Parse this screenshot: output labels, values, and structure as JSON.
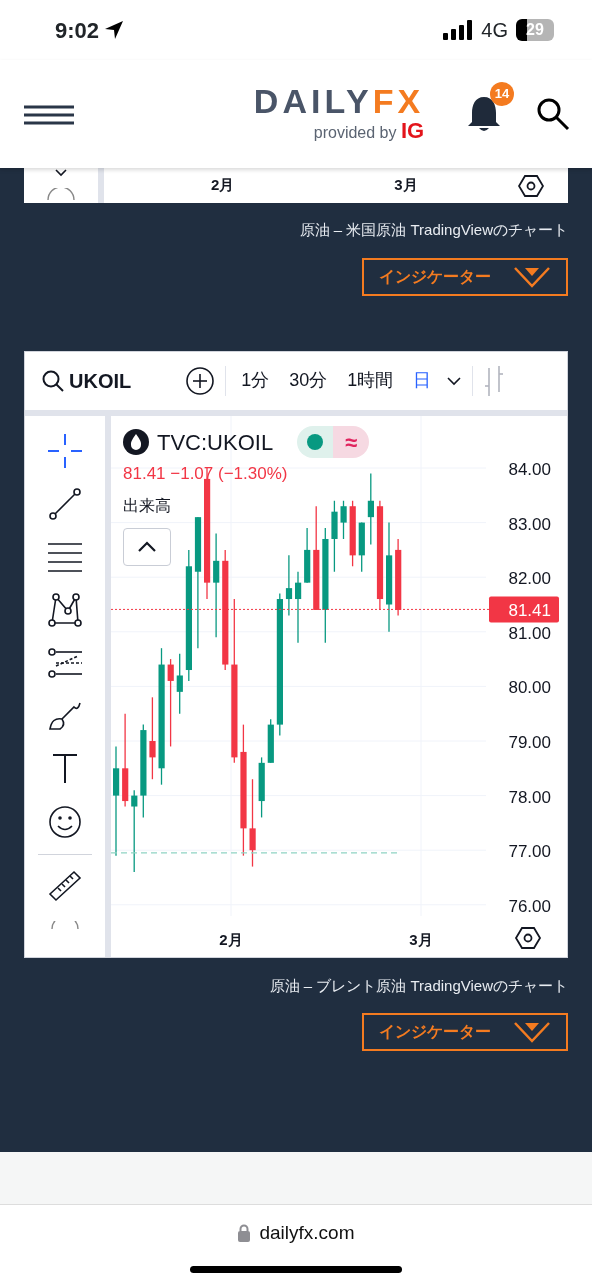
{
  "status_bar": {
    "time": "9:02",
    "network": "4G",
    "battery": "29"
  },
  "header": {
    "wordmark_left": "DAILY",
    "wordmark_right": "FX",
    "tagline": "provided by",
    "tagline_brand": "IG",
    "notification_count": "14"
  },
  "chart_widgets": [
    {
      "kind": "cut",
      "time_axis": [
        "2月",
        "3月"
      ],
      "caption": "原油 – 米国原油 TradingViewのチャート",
      "indicator_button": "インジケーター"
    },
    {
      "kind": "full",
      "symbol_search": "UKOIL",
      "intervals": [
        {
          "label": "1分",
          "selected": false
        },
        {
          "label": "30分",
          "selected": false
        },
        {
          "label": "1時間",
          "selected": false
        },
        {
          "label": "日",
          "selected": true
        }
      ],
      "tools": [
        {
          "selected": true
        },
        {
          "selected": false
        },
        {
          "selected": false
        },
        {
          "selected": false
        },
        {
          "selected": false
        },
        {
          "selected": false
        },
        {
          "selected": false
        },
        {
          "selected": false
        },
        {
          "selected": false
        }
      ],
      "legend": {
        "symbol": "TVC:UKOIL",
        "status_glyph": "≈",
        "quote": "81.41 −1.07 (−1.30%)"
      },
      "volume_label": "出来高",
      "price_axis": [
        "84.00",
        "83.00",
        "82.00",
        "81.00",
        "80.00",
        "79.00",
        "78.00",
        "77.00",
        "76.00"
      ],
      "last_price": "81.41",
      "time_axis": [
        "2月",
        "3月"
      ],
      "caption": "原油 – ブレント原油 TradingViewのチャート",
      "indicator_button": "インジケーター"
    }
  ],
  "address_bar": {
    "url": "dailyfx.com"
  }
}
